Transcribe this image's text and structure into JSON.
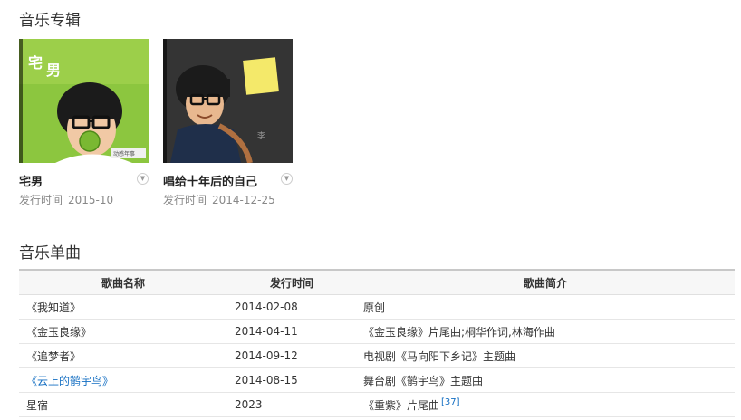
{
  "albums_section": {
    "title": "音乐专辑",
    "albums": [
      {
        "name": "宅男",
        "date_label": "发行时间",
        "date": "2015-10"
      },
      {
        "name": "唱给十年后的自己",
        "date_label": "发行时间",
        "date": "2014-12-25"
      }
    ]
  },
  "singles_section": {
    "title": "音乐单曲",
    "headers": [
      "歌曲名称",
      "发行时间",
      "歌曲简介"
    ],
    "rows": [
      {
        "name": "《我知道》",
        "date": "2014-02-08",
        "desc": "原创",
        "link": false,
        "ref": ""
      },
      {
        "name": "《金玉良缘》",
        "date": "2014-04-11",
        "desc": "《金玉良缘》片尾曲;桐华作词,林海作曲",
        "link": false,
        "ref": ""
      },
      {
        "name": "《追梦者》",
        "date": "2014-09-12",
        "desc": "电视剧《马向阳下乡记》主题曲",
        "link": false,
        "ref": ""
      },
      {
        "name": "《云上的鹡宇鸟》",
        "date": "2014-08-15",
        "desc": "舞台剧《鹡宇鸟》主题曲",
        "link": true,
        "ref": ""
      },
      {
        "name": "星宿",
        "date": "2023",
        "desc": "《重紫》片尾曲",
        "link": false,
        "ref": "[37]"
      }
    ]
  },
  "colors": {
    "link": "#136ec2",
    "cover1_bg": "#8cc63f",
    "cover2_bg": "#3a3a3a"
  }
}
